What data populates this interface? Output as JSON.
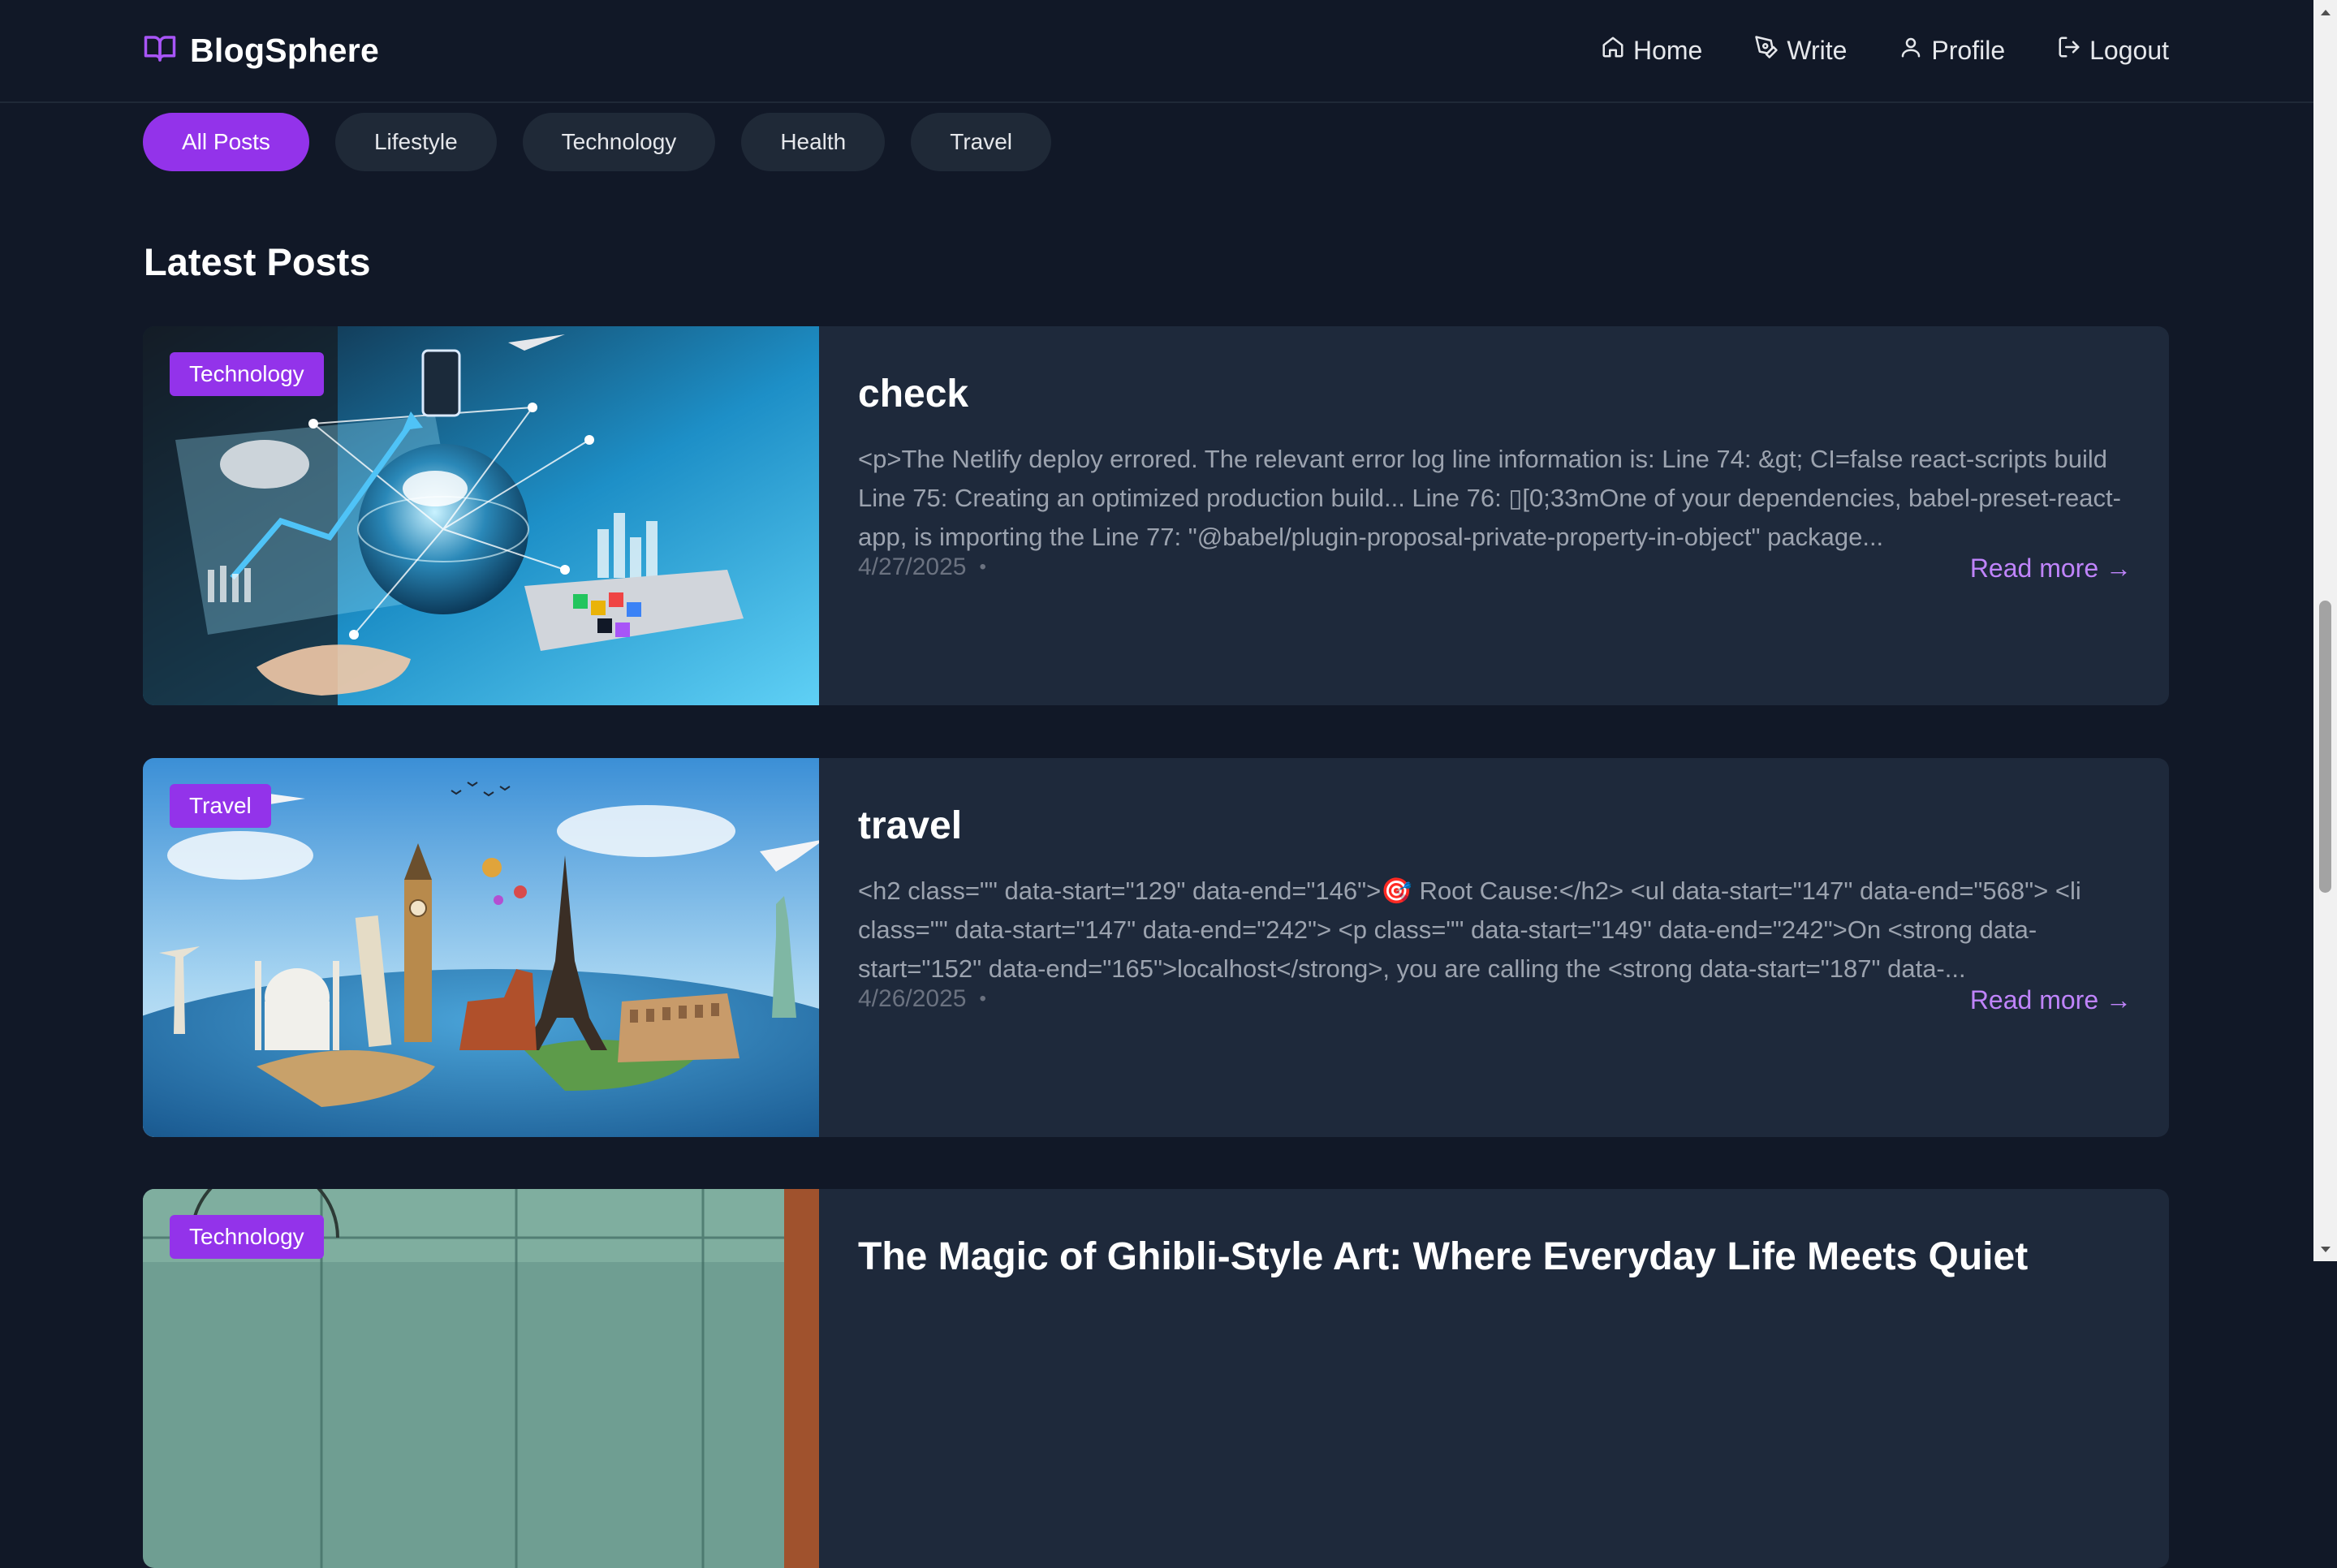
{
  "app": {
    "name": "BlogSphere",
    "icon": "book-open-icon",
    "accent_color": "#9333ea",
    "link_color": "#c084fc",
    "background_color": "#111827",
    "card_color": "#1e293b"
  },
  "nav": [
    {
      "label": "Home",
      "icon": "home-icon"
    },
    {
      "label": "Write",
      "icon": "pen-icon"
    },
    {
      "label": "Profile",
      "icon": "user-icon"
    },
    {
      "label": "Logout",
      "icon": "logout-icon"
    }
  ],
  "filters": [
    {
      "label": "All Posts",
      "active": true
    },
    {
      "label": "Lifestyle",
      "active": false
    },
    {
      "label": "Technology",
      "active": false
    },
    {
      "label": "Health",
      "active": false
    },
    {
      "label": "Travel",
      "active": false
    }
  ],
  "section_title": "Latest Posts",
  "posts": [
    {
      "category": "Technology",
      "title": "check",
      "excerpt": "<p>The Netlify deploy errored. The relevant error log line information is: Line 74: &gt; CI=false react-scripts build Line 75: Creating an optimized production build... Line 76: ▯[0;33mOne of your dependencies, babel-preset-react-app, is importing the Line 77: \"@babel/plugin-proposal-private-property-in-object\" package...",
      "date": "4/27/2025",
      "separator": "•",
      "read_more": "Read more →"
    },
    {
      "category": "Travel",
      "title": "travel",
      "excerpt": "<h2 class=\"\" data-start=\"129\" data-end=\"146\">🎯 Root Cause:</h2> <ul data-start=\"147\" data-end=\"568\"> <li class=\"\" data-start=\"147\" data-end=\"242\"> <p class=\"\" data-start=\"149\" data-end=\"242\">On <strong data-start=\"152\" data-end=\"165\">localhost</strong>, you are calling the <strong data-start=\"187\" data-...",
      "date": "4/26/2025",
      "separator": "•",
      "read_more": "Read more →"
    },
    {
      "category": "Technology",
      "title": "The Magic of Ghibli-Style Art: Where Everyday Life Meets Quiet"
    }
  ]
}
